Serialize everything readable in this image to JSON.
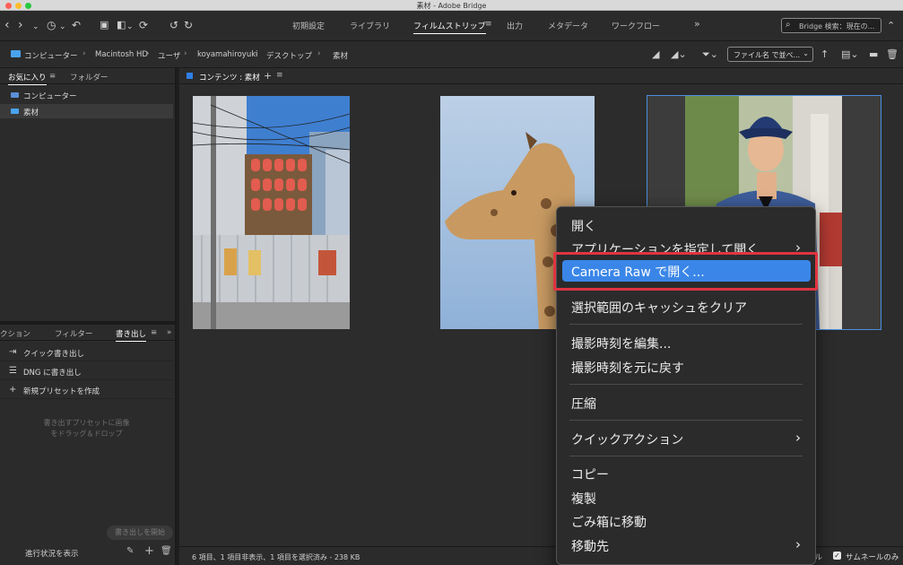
{
  "window": {
    "title": "素材 - Adobe Bridge"
  },
  "toolbar": {
    "workspaces": [
      {
        "label": "初期設定"
      },
      {
        "label": "ライブラリ"
      },
      {
        "label": "フィルムストリップ"
      },
      {
        "label": "出力"
      },
      {
        "label": "メタデータ"
      },
      {
        "label": "ワークフロー"
      }
    ],
    "active_workspace": "フィルムストリップ",
    "search_placeholder": "Bridge 検索：現在の..."
  },
  "pathbar": {
    "crumbs": [
      {
        "label": "コンピューター"
      },
      {
        "label": "Macintosh HD"
      },
      {
        "label": "ユーザ"
      },
      {
        "label": "koyamahiroyuki"
      },
      {
        "label": "デスクトップ"
      },
      {
        "label": "素材"
      }
    ],
    "sort_label": "ファイル名 で並べ..."
  },
  "favorites_panel": {
    "tabs": [
      {
        "label": "お気に入り"
      },
      {
        "label": "フォルダー"
      }
    ],
    "items": [
      {
        "label": "コンピューター",
        "selected": false
      },
      {
        "label": "素材",
        "selected": true
      }
    ]
  },
  "export_panel": {
    "tabs": [
      {
        "label": "クション"
      },
      {
        "label": "フィルター"
      },
      {
        "label": "書き出し"
      }
    ],
    "items": [
      {
        "label": "クイック書き出し"
      },
      {
        "label": "DNG に書き出し"
      },
      {
        "label": "新規プリセットを作成"
      }
    ],
    "drop_hint_line1": "書き出すプリセットに画像",
    "drop_hint_line2": "をドラッグ＆ドロップ",
    "start_button": "書き出しを開始",
    "progress_link": "進行状況を表示"
  },
  "content": {
    "title": "コンテンツ : 素材",
    "status": "6 項目、1 項目非表示、1 項目を選択済み - 238 KB",
    "thumb_only_prefix": "イル",
    "thumb_only_label": "サムネールのみ"
  },
  "context_menu": {
    "items": [
      {
        "label": "開く"
      },
      {
        "label": "アプリケーションを指定して開く"
      },
      {
        "label": "Camera Raw で開く..."
      },
      {
        "label": "選択範囲のキャッシュをクリア"
      },
      {
        "label": "撮影時刻を編集..."
      },
      {
        "label": "撮影時刻を元に戻す"
      },
      {
        "label": "圧縮"
      },
      {
        "label": "クイックアクション"
      },
      {
        "label": "コピー"
      },
      {
        "label": "複製"
      },
      {
        "label": "ごみ箱に移動"
      },
      {
        "label": "移動先"
      }
    ],
    "highlighted": "Camera Raw で開く..."
  },
  "colors": {
    "accent": "#3a86e8",
    "highlight_outline": "#e0343f",
    "folder": "#4aa3ee"
  }
}
